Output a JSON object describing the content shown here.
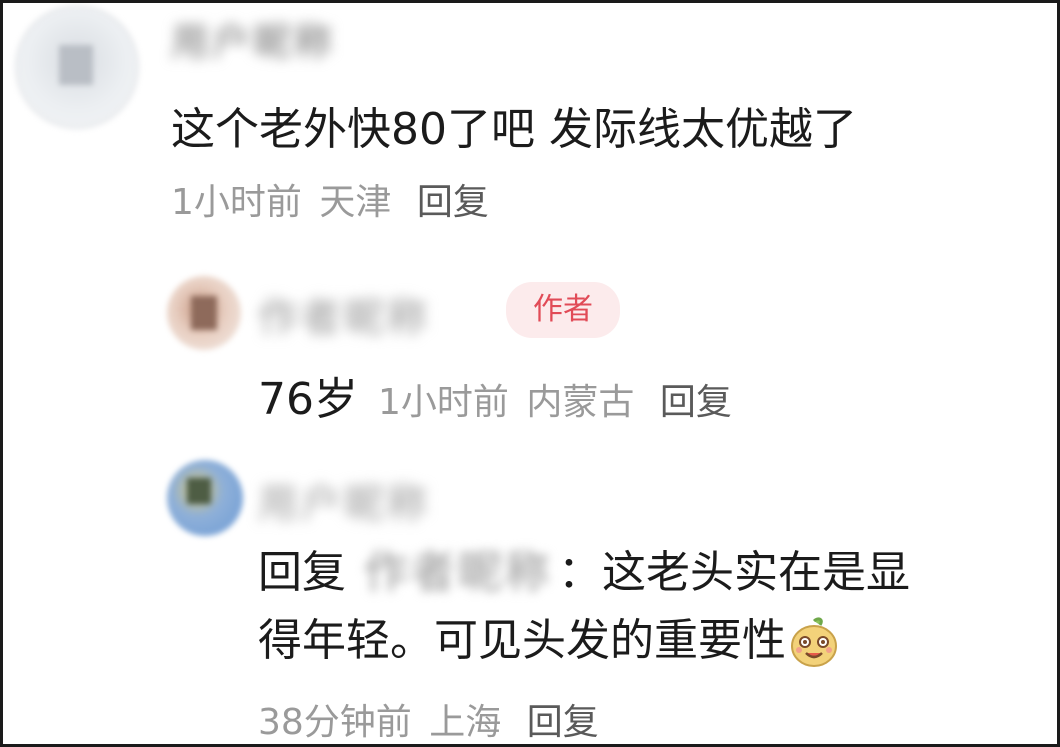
{
  "comments": [
    {
      "user": "用户昵称",
      "text": "这个老外快80了吧 发际线太优越了",
      "time": "1小时前",
      "location": "天津",
      "reply_label": "回复"
    },
    {
      "user": "作者昵称",
      "badge": "作者",
      "text": "76岁",
      "time": "1小时前",
      "location": "内蒙古",
      "reply_label": "回复"
    },
    {
      "user": "用户昵称",
      "reply_prefix": "回复",
      "reply_to_user": "作者昵称",
      "colon": "：",
      "text_line1": "这老头实在是显",
      "text_line2": "得年轻。可见头发的重要性",
      "emoji": "smile-sticker-icon",
      "time": "38分钟前",
      "location": "上海",
      "reply_label": "回复"
    }
  ],
  "colors": {
    "badge_bg": "#fcebec",
    "badge_text": "#e14b57",
    "meta_text": "#9a9a9a"
  }
}
